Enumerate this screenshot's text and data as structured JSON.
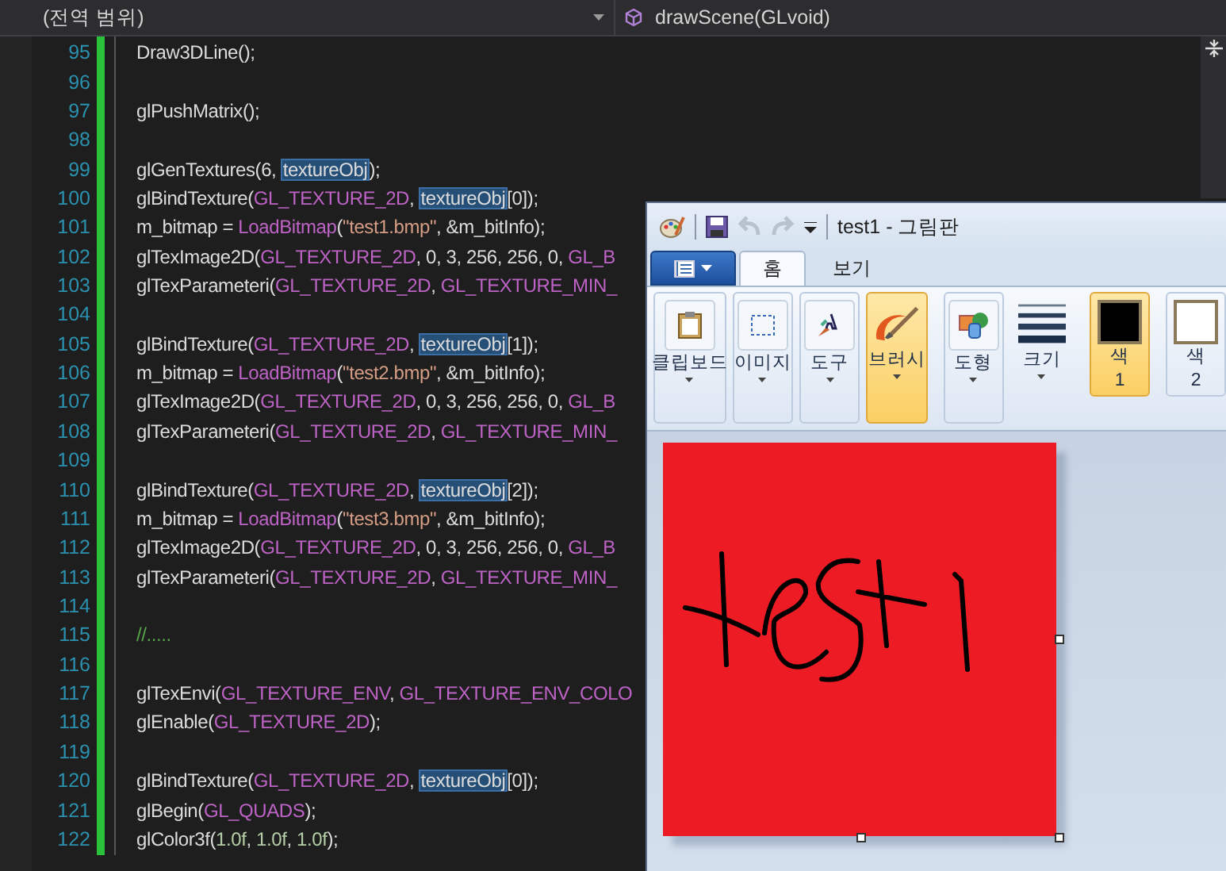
{
  "editor": {
    "scope_dropdown": "(전역 범위)",
    "member_dropdown": "drawScene(GLvoid)",
    "lines": [
      {
        "number": "95",
        "tokens": [
          {
            "kind": "plain",
            "text": "Draw3DLine();"
          }
        ]
      },
      {
        "number": "96"
      },
      {
        "number": "97",
        "tokens": [
          {
            "kind": "plain",
            "text": "glPushMatrix();"
          }
        ]
      },
      {
        "number": "98"
      },
      {
        "number": "99",
        "tokens": [
          {
            "kind": "plain",
            "text": "glGenTextures(6, "
          },
          {
            "kind": "highlight",
            "text": "textureObj"
          },
          {
            "kind": "plain",
            "text": ");"
          }
        ]
      },
      {
        "number": "100",
        "tokens": [
          {
            "kind": "plain",
            "text": "glBindTexture("
          },
          {
            "kind": "macro",
            "text": "GL_TEXTURE_2D",
            "trail": ", "
          },
          {
            "kind": "highlight",
            "text": "textureObj"
          },
          {
            "kind": "plain",
            "text": "[0]);"
          }
        ]
      },
      {
        "number": "101",
        "tokens": [
          {
            "kind": "plain",
            "text": "m_bitmap = "
          },
          {
            "kind": "macro",
            "text": "LoadBitmap"
          },
          {
            "kind": "plain",
            "text": "("
          },
          {
            "kind": "string",
            "text": "\"test1.bmp\""
          },
          {
            "kind": "plain",
            "text": ", &m_bitInfo);"
          }
        ]
      },
      {
        "number": "102",
        "tokens": [
          {
            "kind": "plain",
            "text": "glTexImage2D("
          },
          {
            "kind": "macro",
            "text": "GL_TEXTURE_2D"
          },
          {
            "kind": "plain",
            "text": ", 0, 3, 256, 256, 0, "
          },
          {
            "kind": "macro",
            "text": "GL_B"
          }
        ]
      },
      {
        "number": "103",
        "tokens": [
          {
            "kind": "plain",
            "text": "glTexParameteri("
          },
          {
            "kind": "macro",
            "text": "GL_TEXTURE_2D",
            "trail": ", "
          },
          {
            "kind": "macro",
            "text": "GL_TEXTURE_MIN_"
          }
        ]
      },
      {
        "number": "104"
      },
      {
        "number": "105",
        "tokens": [
          {
            "kind": "plain",
            "text": "glBindTexture("
          },
          {
            "kind": "macro",
            "text": "GL_TEXTURE_2D",
            "trail": ", "
          },
          {
            "kind": "highlight",
            "text": "textureObj"
          },
          {
            "kind": "plain",
            "text": "[1]);"
          }
        ]
      },
      {
        "number": "106",
        "tokens": [
          {
            "kind": "plain",
            "text": "m_bitmap = "
          },
          {
            "kind": "macro",
            "text": "LoadBitmap"
          },
          {
            "kind": "plain",
            "text": "("
          },
          {
            "kind": "string",
            "text": "\"test2.bmp\""
          },
          {
            "kind": "plain",
            "text": ", &m_bitInfo);"
          }
        ]
      },
      {
        "number": "107",
        "tokens": [
          {
            "kind": "plain",
            "text": "glTexImage2D("
          },
          {
            "kind": "macro",
            "text": "GL_TEXTURE_2D"
          },
          {
            "kind": "plain",
            "text": ", 0, 3, 256, 256, 0, "
          },
          {
            "kind": "macro",
            "text": "GL_B"
          }
        ]
      },
      {
        "number": "108",
        "tokens": [
          {
            "kind": "plain",
            "text": "glTexParameteri("
          },
          {
            "kind": "macro",
            "text": "GL_TEXTURE_2D",
            "trail": ", "
          },
          {
            "kind": "macro",
            "text": "GL_TEXTURE_MIN_"
          }
        ]
      },
      {
        "number": "109"
      },
      {
        "number": "110",
        "tokens": [
          {
            "kind": "plain",
            "text": "glBindTexture("
          },
          {
            "kind": "macro",
            "text": "GL_TEXTURE_2D",
            "trail": ", "
          },
          {
            "kind": "highlight",
            "text": "textureObj"
          },
          {
            "kind": "plain",
            "text": "[2]);"
          }
        ]
      },
      {
        "number": "111",
        "tokens": [
          {
            "kind": "plain",
            "text": "m_bitmap = "
          },
          {
            "kind": "macro",
            "text": "LoadBitmap"
          },
          {
            "kind": "plain",
            "text": "("
          },
          {
            "kind": "string",
            "text": "\"test3.bmp\""
          },
          {
            "kind": "plain",
            "text": ", &m_bitInfo);"
          }
        ]
      },
      {
        "number": "112",
        "tokens": [
          {
            "kind": "plain",
            "text": "glTexImage2D("
          },
          {
            "kind": "macro",
            "text": "GL_TEXTURE_2D"
          },
          {
            "kind": "plain",
            "text": ", 0, 3, 256, 256, 0, "
          },
          {
            "kind": "macro",
            "text": "GL_B"
          }
        ]
      },
      {
        "number": "113",
        "tokens": [
          {
            "kind": "plain",
            "text": "glTexParameteri("
          },
          {
            "kind": "macro",
            "text": "GL_TEXTURE_2D",
            "trail": ", "
          },
          {
            "kind": "macro",
            "text": "GL_TEXTURE_MIN_"
          }
        ]
      },
      {
        "number": "114"
      },
      {
        "number": "115",
        "tokens": [
          {
            "kind": "comment",
            "text": "//....."
          }
        ]
      },
      {
        "number": "116"
      },
      {
        "number": "117",
        "tokens": [
          {
            "kind": "plain",
            "text": "glTexEnvi("
          },
          {
            "kind": "macro",
            "text": "GL_TEXTURE_ENV",
            "trail": ", "
          },
          {
            "kind": "macro",
            "text": "GL_TEXTURE_ENV_COLO"
          }
        ]
      },
      {
        "number": "118",
        "tokens": [
          {
            "kind": "plain",
            "text": "glEnable("
          },
          {
            "kind": "macro",
            "text": "GL_TEXTURE_2D"
          },
          {
            "kind": "plain",
            "text": ");"
          }
        ]
      },
      {
        "number": "119"
      },
      {
        "number": "120",
        "tokens": [
          {
            "kind": "plain",
            "text": "glBindTexture("
          },
          {
            "kind": "macro",
            "text": "GL_TEXTURE_2D",
            "trail": ", "
          },
          {
            "kind": "highlight",
            "text": "textureObj"
          },
          {
            "kind": "plain",
            "text": "[0]);"
          }
        ]
      },
      {
        "number": "121",
        "tokens": [
          {
            "kind": "plain",
            "text": "glBegin("
          },
          {
            "kind": "macro",
            "text": "GL_QUADS"
          },
          {
            "kind": "plain",
            "text": ");"
          }
        ]
      },
      {
        "number": "122",
        "tokens": [
          {
            "kind": "plain",
            "text": "glColor3f("
          },
          {
            "kind": "number",
            "text": "1.0f",
            "trail": ", "
          },
          {
            "kind": "number",
            "text": "1.0f",
            "trail": ", "
          },
          {
            "kind": "number",
            "text": "1.0f"
          },
          {
            "kind": "plain",
            "text": ");"
          }
        ]
      }
    ]
  },
  "paint": {
    "title": "test1 - 그림판",
    "tabs": [
      {
        "label": "홈",
        "selected": true
      },
      {
        "label": "보기",
        "selected": false
      }
    ],
    "groups": [
      {
        "kind": "clipboard",
        "label": "클립보드",
        "selected": false
      },
      {
        "kind": "image",
        "label": "이미지",
        "selected": false
      },
      {
        "kind": "tools",
        "label": "도구",
        "selected": false
      },
      {
        "kind": "brush",
        "label": "브러시",
        "selected": true
      },
      {
        "kind": "shapes",
        "label": "도형",
        "selected": false
      },
      {
        "kind": "size",
        "label": "크기",
        "selected": false
      },
      {
        "kind": "color",
        "label": "색",
        "sub": "1",
        "selected": true,
        "color": "#000000"
      },
      {
        "kind": "color",
        "label": "색",
        "sub": "2",
        "selected": false,
        "color": "#ffffff"
      }
    ]
  }
}
